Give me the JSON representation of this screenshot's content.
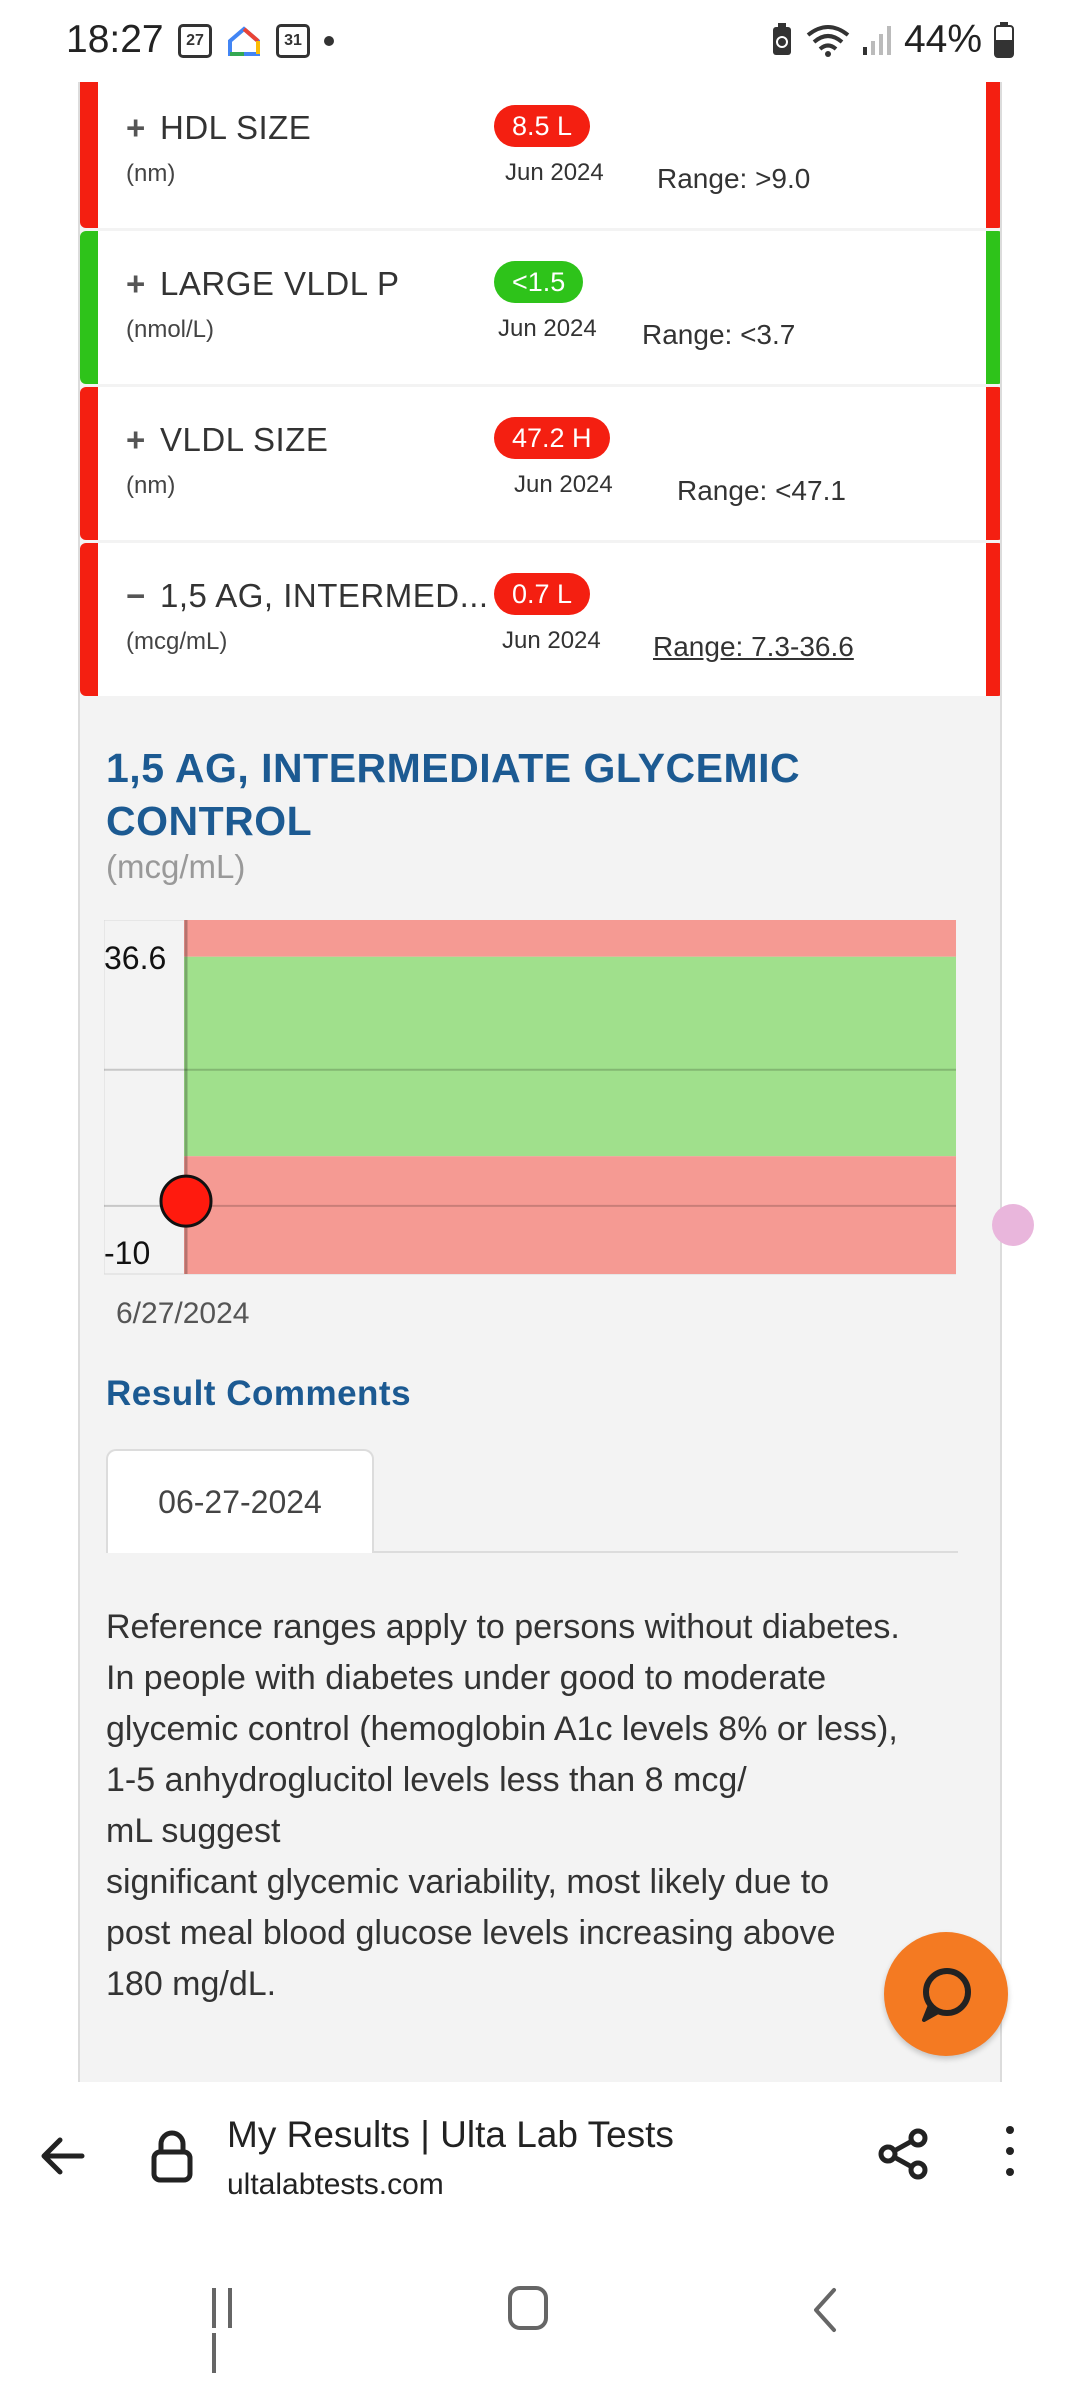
{
  "status_bar": {
    "time": "18:27",
    "left_icons": [
      "calendar-27-icon",
      "google-home-icon",
      "calendar-31-icon",
      "dot-icon"
    ],
    "left_icon_text": [
      "27",
      "31"
    ],
    "battery_percent": "44%",
    "right_icons": [
      "battery-saver-icon",
      "wifi-icon",
      "signal-icon",
      "battery-icon"
    ]
  },
  "results": [
    {
      "name": "HDL SIZE",
      "toggle": "+",
      "unit": "(nm)",
      "value": "8.5 L",
      "status": "red",
      "date": "Jun 2024",
      "range": "Range: >9.0",
      "range_link": false
    },
    {
      "name": "LARGE VLDL P",
      "toggle": "+",
      "unit": "(nmol/L)",
      "value": "<1.5",
      "status": "green",
      "date": "Jun 2024",
      "range": "Range: <3.7",
      "range_link": false
    },
    {
      "name": "VLDL SIZE",
      "toggle": "+",
      "unit": "(nm)",
      "value": "47.2 H",
      "status": "red",
      "date": "Jun 2024",
      "range": "Range: <47.1",
      "range_link": false
    },
    {
      "name": "1,5 AG, INTERMED...",
      "toggle": "−",
      "unit": "(mcg/mL)",
      "value": "0.7 L",
      "status": "red",
      "date": "Jun 2024",
      "range": "Range: 7.3-36.6",
      "range_link": true
    }
  ],
  "colors": {
    "red": "#f41f11",
    "green": "#2ec31a",
    "accent": "#1c5a92",
    "fab": "#f47a22"
  },
  "detail": {
    "title_line1": "1,5 AG, INTERMEDIATE GLYCEMIC",
    "title_line2": "CONTROL",
    "unit": "(mcg/mL)"
  },
  "chart_data": {
    "type": "scatter",
    "title": "",
    "y_tick_labels": [
      "36.6",
      "-10"
    ],
    "ylim": [
      -10,
      42
    ],
    "x_tick_labels": [
      "6/27/2024"
    ],
    "normal_range": [
      7.3,
      36.6
    ],
    "points": [
      {
        "x": "6/27/2024",
        "y": 0.7
      }
    ],
    "band_colors": {
      "low": "#f59a93",
      "normal": "#a0e08c",
      "high": "#f59a93"
    },
    "point_color": "#ff1a0e",
    "grid": true
  },
  "comments": {
    "title": "Result Comments",
    "tab_label": "06-27-2024",
    "lines": [
      "Reference ranges apply to persons without diabetes.",
      "In people with diabetes under good to moderate",
      "glycemic control (hemoglobin A1c levels 8% or less),",
      "1-5 anhydroglucitol levels less than 8 mcg/",
      "mL suggest",
      "significant glycemic variability, most likely due to",
      "post meal blood glucose levels increasing above",
      "180 mg/dL."
    ]
  },
  "browser": {
    "title": "My Results | Ulta Lab Tests",
    "url": "ultalabtests.com"
  }
}
